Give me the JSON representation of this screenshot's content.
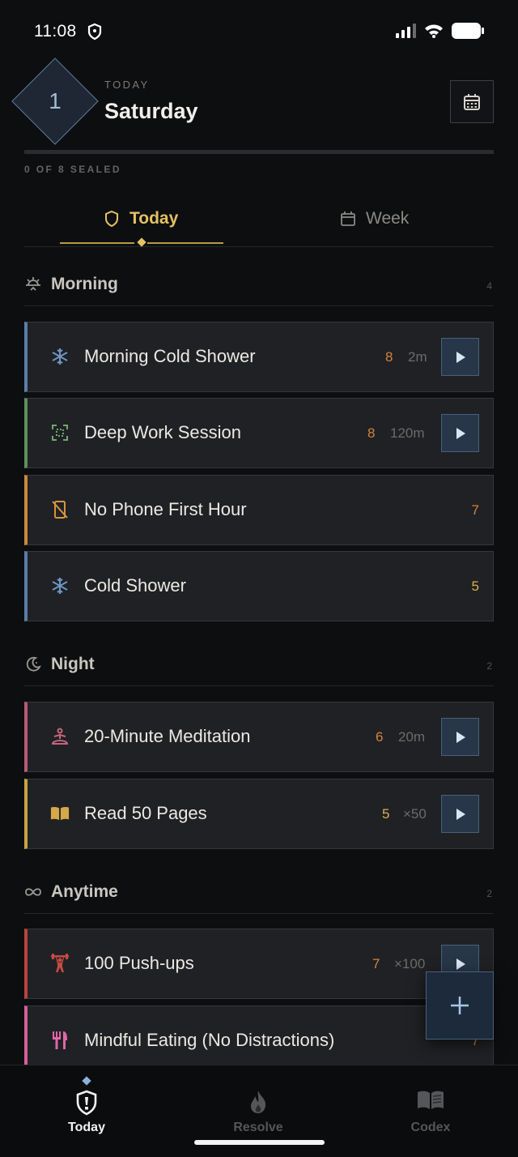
{
  "status_bar": {
    "time": "11:08"
  },
  "header": {
    "level": "1",
    "today_label": "TODAY",
    "day": "Saturday",
    "sealed": "0 OF 8 SEALED"
  },
  "tabs": [
    {
      "label": "Today",
      "active": true
    },
    {
      "label": "Week",
      "active": false
    }
  ],
  "sections": [
    {
      "title": "Morning",
      "count": "4",
      "items": [
        {
          "title": "Morning Cold Shower",
          "score": "8",
          "meta": "2m",
          "icon": "snowflake-icon",
          "accent": "#5b7ea8",
          "score_color": "#d0843f",
          "has_play": true
        },
        {
          "title": "Deep Work Session",
          "score": "8",
          "meta": "120m",
          "icon": "focus-icon",
          "accent": "#5f8f5c",
          "score_color": "#d0843f",
          "has_play": true
        },
        {
          "title": "No Phone First Hour",
          "score": "7",
          "meta": "",
          "icon": "no-phone-icon",
          "accent": "#c98a3a",
          "score_color": "#d0843f",
          "has_play": false
        },
        {
          "title": "Cold Shower",
          "score": "5",
          "meta": "",
          "icon": "snowflake-icon",
          "accent": "#5b7ea8",
          "score_color": "#d8b14a",
          "has_play": false
        }
      ]
    },
    {
      "title": "Night",
      "count": "2",
      "items": [
        {
          "title": "20-Minute Meditation",
          "score": "6",
          "meta": "20m",
          "icon": "meditation-icon",
          "accent": "#b75b74",
          "score_color": "#d0843f",
          "has_play": true
        },
        {
          "title": "Read 50 Pages",
          "score": "5",
          "meta": "×50",
          "icon": "book-icon",
          "accent": "#c9a443",
          "score_color": "#d8b14a",
          "has_play": true
        }
      ]
    },
    {
      "title": "Anytime",
      "count": "2",
      "items": [
        {
          "title": "100 Push-ups",
          "score": "7",
          "meta": "×100",
          "icon": "weightlifter-icon",
          "accent": "#b9433e",
          "score_color": "#d0843f",
          "has_play": true
        },
        {
          "title": "Mindful Eating (No Distractions)",
          "score": "7",
          "meta": "",
          "icon": "utensils-icon",
          "accent": "#d45f9b",
          "score_color": "#d0843f",
          "has_play": false
        }
      ]
    }
  ],
  "nav": [
    {
      "label": "Today",
      "icon": "shield-icon",
      "active": true
    },
    {
      "label": "Resolve",
      "icon": "flame-icon",
      "active": false
    },
    {
      "label": "Codex",
      "icon": "book-icon",
      "active": false
    }
  ],
  "colors": {
    "accent_gold": "#e5c163",
    "accent_blue": "#8ab1dc",
    "background": "#0d0e10"
  }
}
